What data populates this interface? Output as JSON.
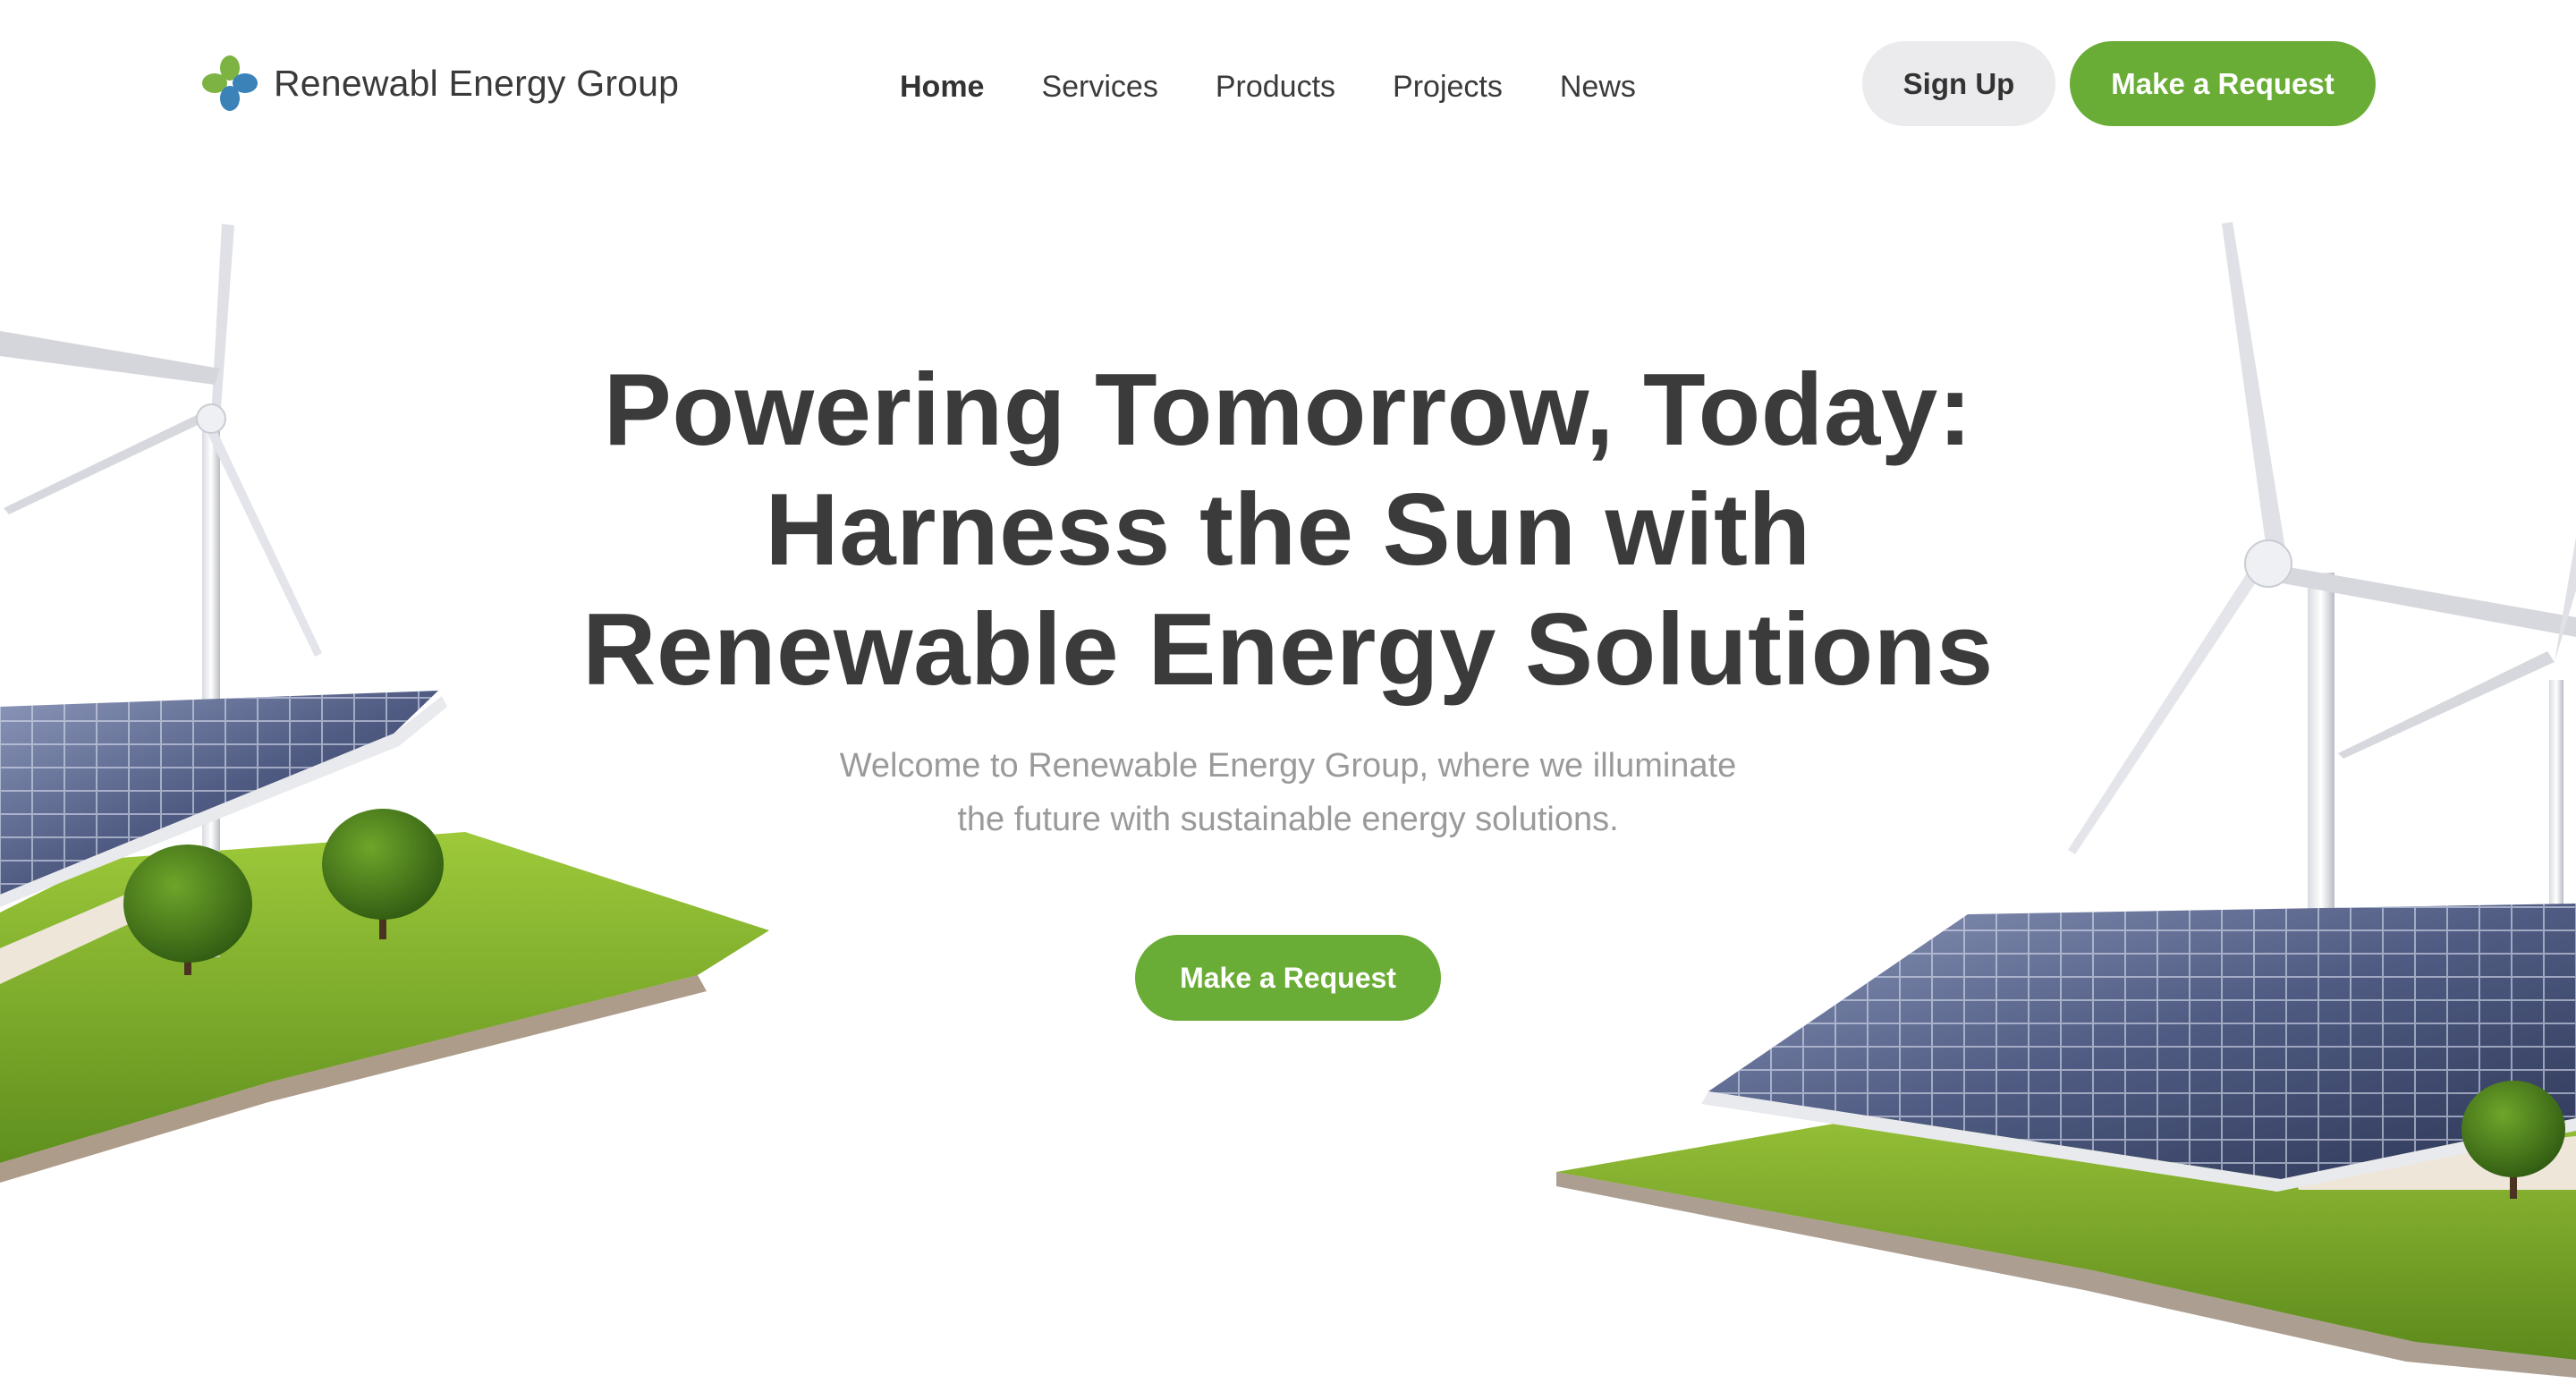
{
  "header": {
    "logo_text": "Renewabl Energy Group",
    "nav": [
      {
        "label": "Home",
        "active": true
      },
      {
        "label": "Services",
        "active": false
      },
      {
        "label": "Products",
        "active": false
      },
      {
        "label": "Projects",
        "active": false
      },
      {
        "label": "News",
        "active": false
      }
    ],
    "signup_label": "Sign Up",
    "request_label": "Make a Request"
  },
  "hero": {
    "title_line1": "Powering Tomorrow, Today:",
    "title_line2": "Harness the Sun with",
    "title_line3": "Renewable Energy Solutions",
    "subtitle_line1": "Welcome to Renewable Energy Group, where we illuminate",
    "subtitle_line2": "the future with sustainable energy solutions.",
    "cta_label": "Make a Request"
  },
  "colors": {
    "accent_green": "#6aad36",
    "logo_green": "#7cb342",
    "logo_blue": "#3a82b8",
    "text_dark": "#3b3b3c",
    "text_muted": "#9a9a9a",
    "button_gray": "#ebebee"
  },
  "icons": {
    "logo": "four-petal-logo-icon"
  }
}
